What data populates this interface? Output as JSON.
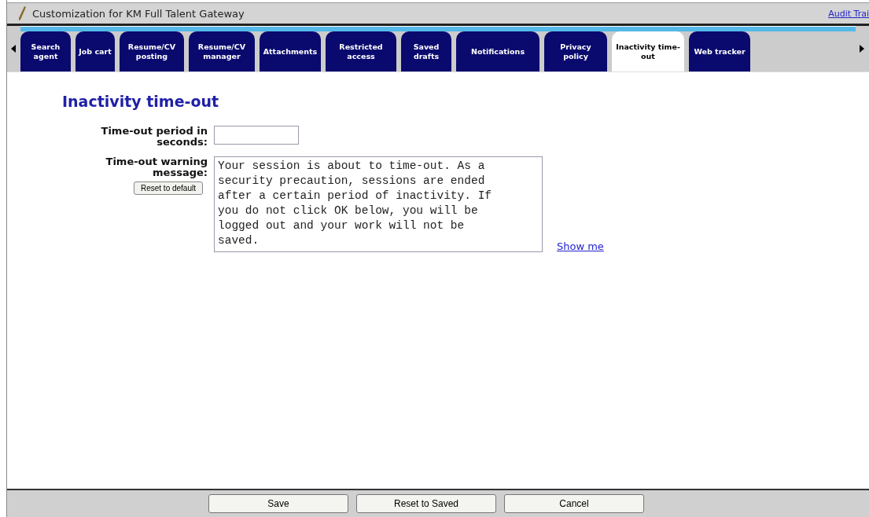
{
  "header": {
    "title": "Customization for KM Full Talent Gateway",
    "link": "Audit Trai"
  },
  "tabs": [
    {
      "label": "Search agent",
      "selected": false
    },
    {
      "label": "Job cart",
      "selected": false
    },
    {
      "label": "Resume/CV posting",
      "selected": false
    },
    {
      "label": "Resume/CV manager",
      "selected": false
    },
    {
      "label": "Attachments",
      "selected": false
    },
    {
      "label": "Restricted access",
      "selected": false
    },
    {
      "label": "Saved drafts",
      "selected": false
    },
    {
      "label": "Notifications",
      "selected": false
    },
    {
      "label": "Privacy policy",
      "selected": false
    },
    {
      "label": "Inactivity time-out",
      "selected": true
    },
    {
      "label": "Web tracker",
      "selected": false
    }
  ],
  "page": {
    "heading": "Inactivity time-out",
    "period": {
      "label": "Time-out period in seconds:"
    },
    "warning": {
      "label": "Time-out warning message:",
      "reset_button": "Reset to default",
      "value": "Your session is about to time-out. As a security precaution, sessions are ended after a certain period of inactivity. If you do not click OK below, you will be logged out and your work will not be saved.",
      "link": "Show me"
    }
  },
  "footer": {
    "buttons": [
      "Save",
      "Reset to Saved",
      "Cancel"
    ]
  }
}
